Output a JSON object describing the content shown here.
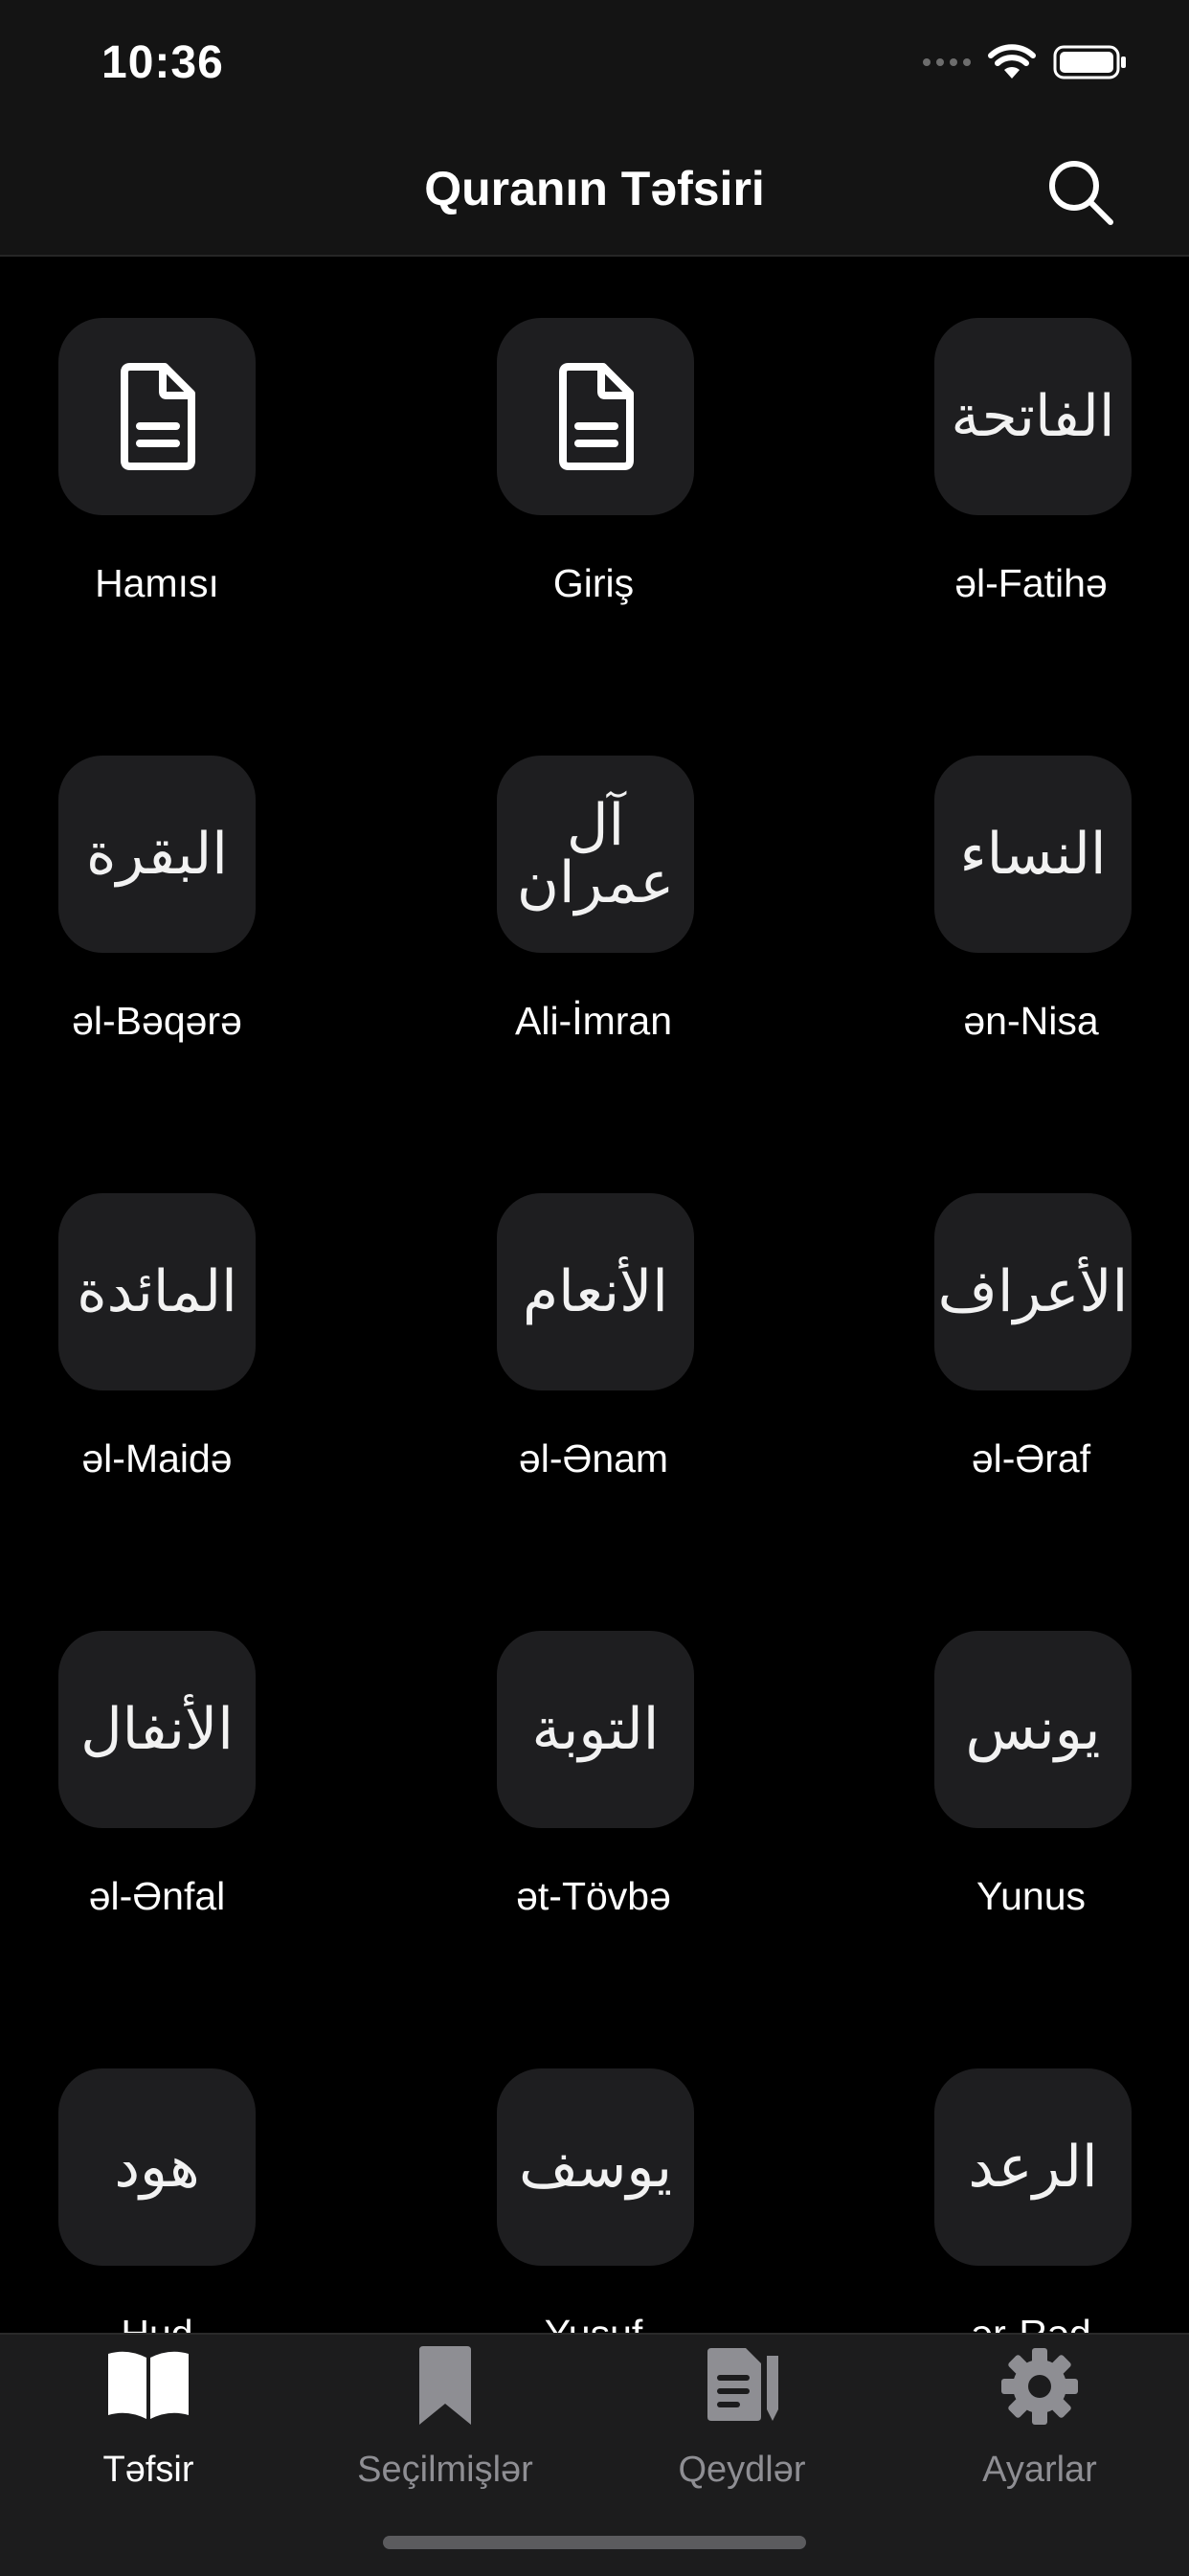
{
  "status_bar": {
    "time": "10:36"
  },
  "nav": {
    "title": "Quranın Təfsiri"
  },
  "grid": {
    "items": [
      {
        "label": "Hamısı",
        "icon": "document-icon",
        "calligraphy": ""
      },
      {
        "label": "Giriş",
        "icon": "document-icon",
        "calligraphy": ""
      },
      {
        "label": "əl-Fatihə",
        "icon": "calligraphy",
        "calligraphy": "الفاتحة"
      },
      {
        "label": "əl-Bəqərə",
        "icon": "calligraphy",
        "calligraphy": "البقرة"
      },
      {
        "label": "Ali-İmran",
        "icon": "calligraphy",
        "calligraphy": "آل عمران"
      },
      {
        "label": "ən-Nisa",
        "icon": "calligraphy",
        "calligraphy": "النساء"
      },
      {
        "label": "əl-Maidə",
        "icon": "calligraphy",
        "calligraphy": "المائدة"
      },
      {
        "label": "əl-Ənam",
        "icon": "calligraphy",
        "calligraphy": "الأنعام"
      },
      {
        "label": "əl-Əraf",
        "icon": "calligraphy",
        "calligraphy": "الأعراف"
      },
      {
        "label": "əl-Ənfal",
        "icon": "calligraphy",
        "calligraphy": "الأنفال"
      },
      {
        "label": "ət-Tövbə",
        "icon": "calligraphy",
        "calligraphy": "التوبة"
      },
      {
        "label": "Yunus",
        "icon": "calligraphy",
        "calligraphy": "يونس"
      },
      {
        "label": "Hud",
        "icon": "calligraphy",
        "calligraphy": "هود"
      },
      {
        "label": "Yusuf",
        "icon": "calligraphy",
        "calligraphy": "يوسف"
      },
      {
        "label": "ər-Rəd",
        "icon": "calligraphy",
        "calligraphy": "الرعد"
      }
    ]
  },
  "tabs": [
    {
      "label": "Təfsir",
      "icon": "open-book-icon",
      "active": true
    },
    {
      "label": "Seçilmişlər",
      "icon": "bookmark-icon",
      "active": false
    },
    {
      "label": "Qeydlər",
      "icon": "notes-icon",
      "active": false
    },
    {
      "label": "Ayarlar",
      "icon": "gear-icon",
      "active": false
    }
  ],
  "colors": {
    "background": "#000000",
    "tile": "#1e1e20",
    "tab_active": "#ffffff",
    "tab_inactive": "#8e8e93"
  }
}
